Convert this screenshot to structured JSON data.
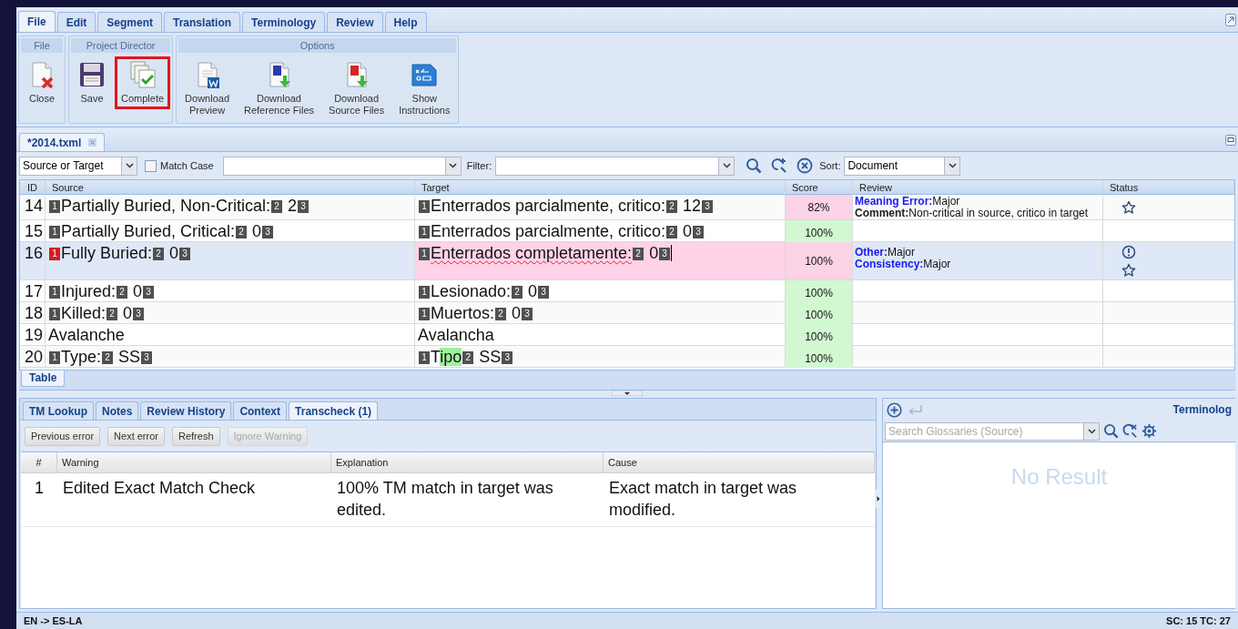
{
  "menu_tabs": [
    {
      "label": "File",
      "selected": true
    },
    {
      "label": "Edit",
      "selected": false
    },
    {
      "label": "Segment",
      "selected": false
    },
    {
      "label": "Translation",
      "selected": false
    },
    {
      "label": "Terminology",
      "selected": false
    },
    {
      "label": "Review",
      "selected": false
    },
    {
      "label": "Help",
      "selected": false
    }
  ],
  "ribbon_groups": [
    {
      "title": "File",
      "buttons": [
        {
          "kind": "close",
          "label": "Close",
          "highlighted": false
        }
      ]
    },
    {
      "title": "Project Director",
      "buttons": [
        {
          "kind": "save",
          "label": "Save",
          "highlighted": false
        },
        {
          "kind": "complete",
          "label": "Complete",
          "highlighted": true
        }
      ]
    },
    {
      "title": "Options",
      "buttons": [
        {
          "kind": "preview",
          "label": "Download\nPreview",
          "highlighted": false
        },
        {
          "kind": "reference",
          "label": "Download\nReference Files",
          "highlighted": false
        },
        {
          "kind": "source",
          "label": "Download\nSource Files",
          "highlighted": false
        },
        {
          "kind": "instructions",
          "label": "Show\nInstructions",
          "highlighted": false
        }
      ]
    }
  ],
  "document_tabs": [
    {
      "label": "*2014.txml",
      "selected": true
    }
  ],
  "toolbar": {
    "scope": "Source or Target",
    "match_case": {
      "label": "Match Case",
      "checked": false
    },
    "filter_label": "Filter:",
    "sort_label": "Sort:",
    "sort": "Document"
  },
  "grid": {
    "columns": [
      "ID",
      "Source",
      "Target",
      "Score",
      "Review",
      "Status"
    ],
    "rows": [
      {
        "id": "14",
        "selected": false,
        "editing": false,
        "score": "82%",
        "color": "#fcd2e6",
        "source": [
          {
            "kind": "tag",
            "text": "1",
            "error": false
          },
          {
            "kind": "text",
            "text": "Partially Buried, Non-Critical:"
          },
          {
            "kind": "tag",
            "text": "2",
            "error": false
          },
          {
            "kind": "text",
            "text": " 2"
          },
          {
            "kind": "tag",
            "text": "3",
            "error": false
          }
        ],
        "target": [
          {
            "kind": "tag",
            "text": "1",
            "error": false
          },
          {
            "kind": "text",
            "text": "Enterrados parcialmente, critico:"
          },
          {
            "kind": "tag",
            "text": "2",
            "error": false
          },
          {
            "kind": "text",
            "text": " 12"
          },
          {
            "kind": "tag",
            "text": "3",
            "error": false
          }
        ],
        "review": [
          {
            "label": "Meaning Error:",
            "value": "Major",
            "kind": "error"
          },
          {
            "label": "Comment:",
            "value": "Non-critical in source, critico in target",
            "kind": "comment"
          }
        ],
        "status": [
          {
            "kind": "star"
          }
        ]
      },
      {
        "id": "15",
        "selected": false,
        "editing": false,
        "score": "100%",
        "color": "#d2f8d2",
        "source": [
          {
            "kind": "tag",
            "text": "1",
            "error": false
          },
          {
            "kind": "text",
            "text": "Partially Buried, Critical:"
          },
          {
            "kind": "tag",
            "text": "2",
            "error": false
          },
          {
            "kind": "text",
            "text": " 0"
          },
          {
            "kind": "tag",
            "text": "3",
            "error": false
          }
        ],
        "target": [
          {
            "kind": "tag",
            "text": "1",
            "error": false
          },
          {
            "kind": "text",
            "text": "Enterrados parcialmente, critico:"
          },
          {
            "kind": "tag",
            "text": "2",
            "error": false
          },
          {
            "kind": "text",
            "text": " 0"
          },
          {
            "kind": "tag",
            "text": "3",
            "error": false
          }
        ],
        "review": [],
        "status": []
      },
      {
        "id": "16",
        "selected": true,
        "editing": true,
        "score": "100%",
        "color": "#fcd2e6",
        "source": [
          {
            "kind": "tag",
            "text": "1",
            "error": true
          },
          {
            "kind": "text",
            "text": "Fully Buried:"
          },
          {
            "kind": "tag",
            "text": "2",
            "error": false
          },
          {
            "kind": "text",
            "text": " 0"
          },
          {
            "kind": "tag",
            "text": "3",
            "error": false
          }
        ],
        "target": [
          {
            "kind": "tag",
            "text": "1",
            "error": false
          },
          {
            "kind": "text",
            "text": "Enterrados completamente:",
            "misspelled": true
          },
          {
            "kind": "tag",
            "text": "2",
            "error": false
          },
          {
            "kind": "text",
            "text": " 0"
          },
          {
            "kind": "tag",
            "text": "3",
            "error": false
          }
        ],
        "review": [
          {
            "label": "Other:",
            "value": "Major",
            "kind": "error"
          },
          {
            "label": "Consistency:",
            "value": "Major",
            "kind": "error"
          }
        ],
        "status": [
          {
            "kind": "warning"
          },
          {
            "kind": "star"
          }
        ]
      },
      {
        "id": "17",
        "selected": false,
        "editing": false,
        "score": "100%",
        "color": "#d2f8d2",
        "source": [
          {
            "kind": "tag",
            "text": "1",
            "error": false
          },
          {
            "kind": "text",
            "text": "Injured:"
          },
          {
            "kind": "tag",
            "text": "2",
            "error": false
          },
          {
            "kind": "text",
            "text": " 0"
          },
          {
            "kind": "tag",
            "text": "3",
            "error": false
          }
        ],
        "target": [
          {
            "kind": "tag",
            "text": "1",
            "error": false
          },
          {
            "kind": "text",
            "text": "Lesionado:"
          },
          {
            "kind": "tag",
            "text": "2",
            "error": false
          },
          {
            "kind": "text",
            "text": " 0"
          },
          {
            "kind": "tag",
            "text": "3",
            "error": false
          }
        ],
        "review": [],
        "status": []
      },
      {
        "id": "18",
        "selected": false,
        "editing": false,
        "score": "100%",
        "color": "#d2f8d2",
        "source": [
          {
            "kind": "tag",
            "text": "1",
            "error": false
          },
          {
            "kind": "text",
            "text": "Killed:"
          },
          {
            "kind": "tag",
            "text": "2",
            "error": false
          },
          {
            "kind": "text",
            "text": " 0"
          },
          {
            "kind": "tag",
            "text": "3",
            "error": false
          }
        ],
        "target": [
          {
            "kind": "tag",
            "text": "1",
            "error": false
          },
          {
            "kind": "text",
            "text": "Muertos:"
          },
          {
            "kind": "tag",
            "text": "2",
            "error": false
          },
          {
            "kind": "text",
            "text": " 0"
          },
          {
            "kind": "tag",
            "text": "3",
            "error": false
          }
        ],
        "review": [],
        "status": []
      },
      {
        "id": "19",
        "selected": false,
        "editing": false,
        "score": "100%",
        "color": "#d2f8d2",
        "source": [
          {
            "kind": "text",
            "text": "Avalanche"
          }
        ],
        "target": [
          {
            "kind": "text",
            "text": "Avalancha"
          }
        ],
        "review": [],
        "status": []
      },
      {
        "id": "20",
        "selected": false,
        "editing": false,
        "score": "100%",
        "color": "#d2f8d2",
        "source": [
          {
            "kind": "tag",
            "text": "1",
            "error": false
          },
          {
            "kind": "text",
            "text": "Type:"
          },
          {
            "kind": "tag",
            "text": "2",
            "error": false
          },
          {
            "kind": "text",
            "text": " SS"
          },
          {
            "kind": "tag",
            "text": "3",
            "error": false
          }
        ],
        "target": [
          {
            "kind": "tag",
            "text": "1",
            "error": false
          },
          {
            "kind": "text",
            "text": "T"
          },
          {
            "kind": "text",
            "text": "ipo",
            "highlighted": true
          },
          {
            "kind": "tag",
            "text": "2",
            "error": false
          },
          {
            "kind": "text",
            "text": " SS"
          },
          {
            "kind": "tag",
            "text": "3",
            "error": false
          }
        ],
        "review": [],
        "status": []
      }
    ]
  },
  "view_tabs": [
    {
      "label": "Table",
      "selected": true
    }
  ],
  "bottom_tabs": [
    {
      "label": "TM Lookup",
      "selected": false
    },
    {
      "label": "Notes",
      "selected": false
    },
    {
      "label": "Review History",
      "selected": false
    },
    {
      "label": "Context",
      "selected": false
    },
    {
      "label": "Transcheck (1)",
      "selected": true
    }
  ],
  "transcheck": {
    "buttons": [
      {
        "label": "Previous error",
        "disabled": false
      },
      {
        "label": "Next error",
        "disabled": false
      },
      {
        "label": "Refresh",
        "disabled": false
      },
      {
        "label": "Ignore Warning",
        "disabled": true
      }
    ],
    "columns": [
      "#",
      "Warning",
      "Explanation",
      "Cause"
    ],
    "rows": [
      {
        "number": "1",
        "warning": "Edited Exact Match Check",
        "explanation": "100% TM match in target was edited.",
        "cause": "Exact match in target was modified."
      }
    ]
  },
  "terminology": {
    "title": "Terminolog",
    "search_placeholder": "Search Glossaries (Source)",
    "empty": "No Result"
  },
  "status_bar": {
    "languages": "EN -> ES-LA",
    "counts": "SC: 15 TC: 27"
  }
}
